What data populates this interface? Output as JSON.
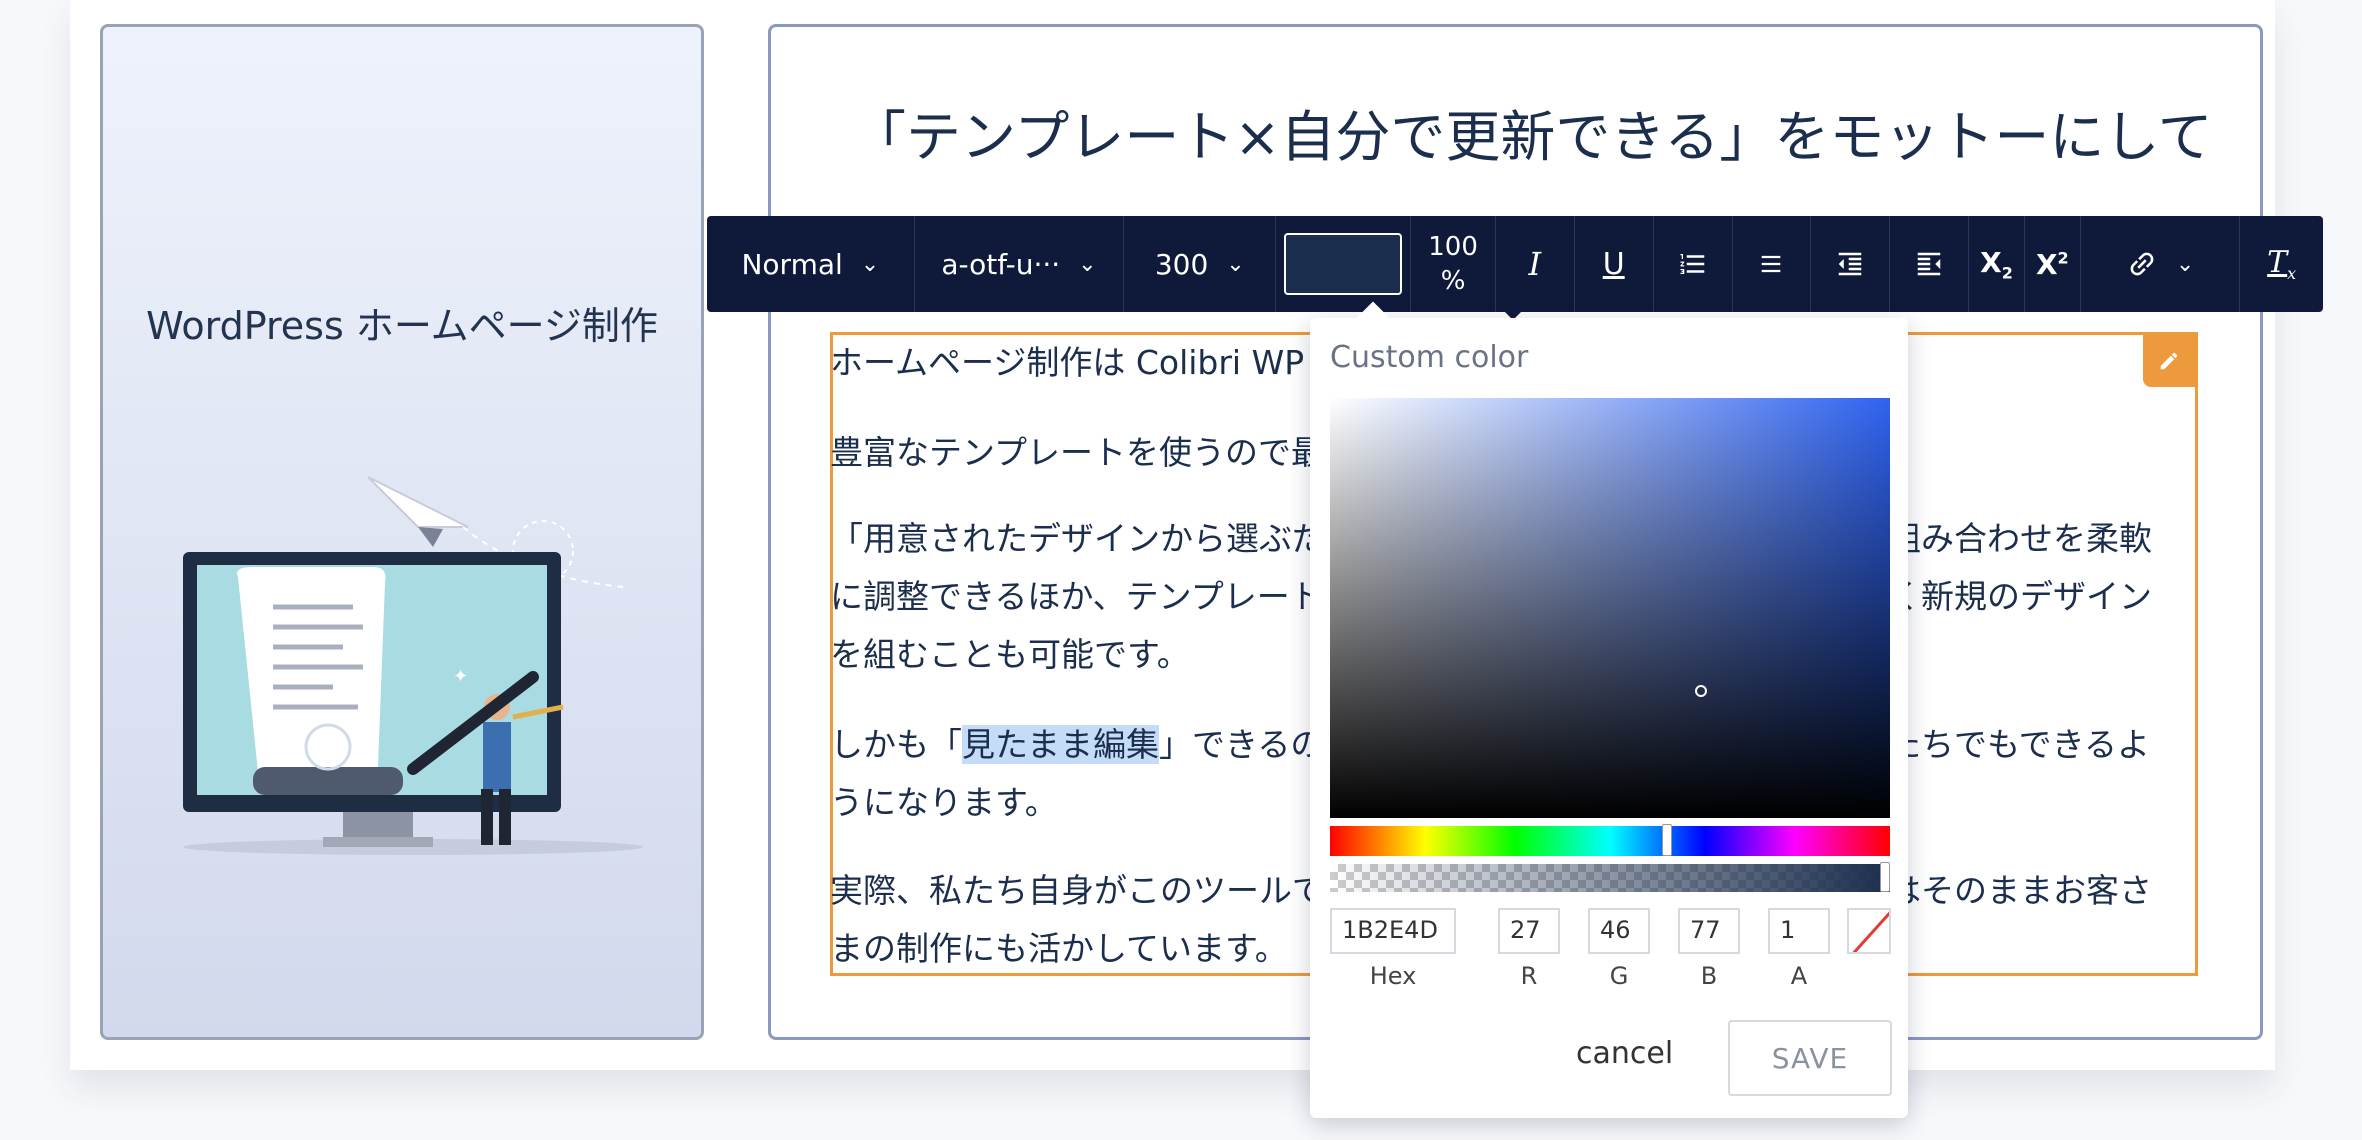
{
  "left_card": {
    "title": "WordPress ホームページ制作"
  },
  "headline": "「テンプレート×自分で更新できる」をモットーにしてま",
  "paragraphs": [
    "ホームページ制作は Colibri WP",
    "豊富なテンプレートを使うので最",
    "「用意されたデザインから選ぶだ",
    "の組み合わせを柔軟",
    "に調整できるほか、テンプレート",
    "たく新規のデザイン",
    "を組むことも可能です。",
    "しかも「",
    "見たまま編集",
    "」できるの",
    "分たちでもできるよ",
    "うになります。",
    "実際、私たち自身がこのツールで",
    "ウはそのままお客さ",
    "まの制作にも活かしています。"
  ],
  "toolbar": {
    "block_format": "Normal",
    "font_family": "a-otf-u···",
    "font_weight": "300",
    "text_color": "#1B2E4D",
    "opacity_value": "100",
    "opacity_unit": "%",
    "buttons": [
      "italic-icon",
      "underline-icon",
      "ordered-list-icon",
      "unordered-list-icon",
      "outdent-icon",
      "indent-icon",
      "subscript-icon",
      "superscript-icon",
      "link-icon",
      "clear-format-icon"
    ]
  },
  "color_picker": {
    "title": "Custom color",
    "hex": "1B2E4D",
    "r": "27",
    "g": "46",
    "b": "77",
    "a": "1",
    "labels": {
      "hex": "Hex",
      "r": "R",
      "g": "G",
      "b": "B",
      "a": "A"
    },
    "cancel_label": "cancel",
    "save_label": "SAVE"
  },
  "colors": {
    "toolbar_bg": "#0F1A3A",
    "accent_orange": "#EC9A3C",
    "text_primary": "#1B2E4D",
    "highlight": "#C4DCF7"
  }
}
